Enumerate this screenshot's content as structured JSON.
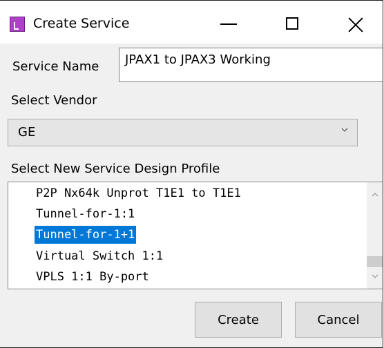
{
  "window": {
    "title": "Create Service",
    "icon": "app-icon"
  },
  "form": {
    "service_name_label": "Service Name",
    "service_name_value": "JPAX1 to JPAX3 Working",
    "vendor_label": "Select Vendor",
    "vendor_value": "GE",
    "profile_label": "Select New Service Design Profile",
    "profiles": [
      {
        "label": "P2P Nx64k Unprot T1E1 to T1E1",
        "selected": false
      },
      {
        "label": "Tunnel-for-1:1",
        "selected": false
      },
      {
        "label": "Tunnel-for-1+1",
        "selected": true
      },
      {
        "label": "Virtual Switch 1:1",
        "selected": false
      },
      {
        "label": "VPLS 1:1 By-port",
        "selected": false
      }
    ]
  },
  "buttons": {
    "create": "Create",
    "cancel": "Cancel"
  },
  "colors": {
    "selection": "#0078d7",
    "window_bg": "#f0f0f0"
  }
}
